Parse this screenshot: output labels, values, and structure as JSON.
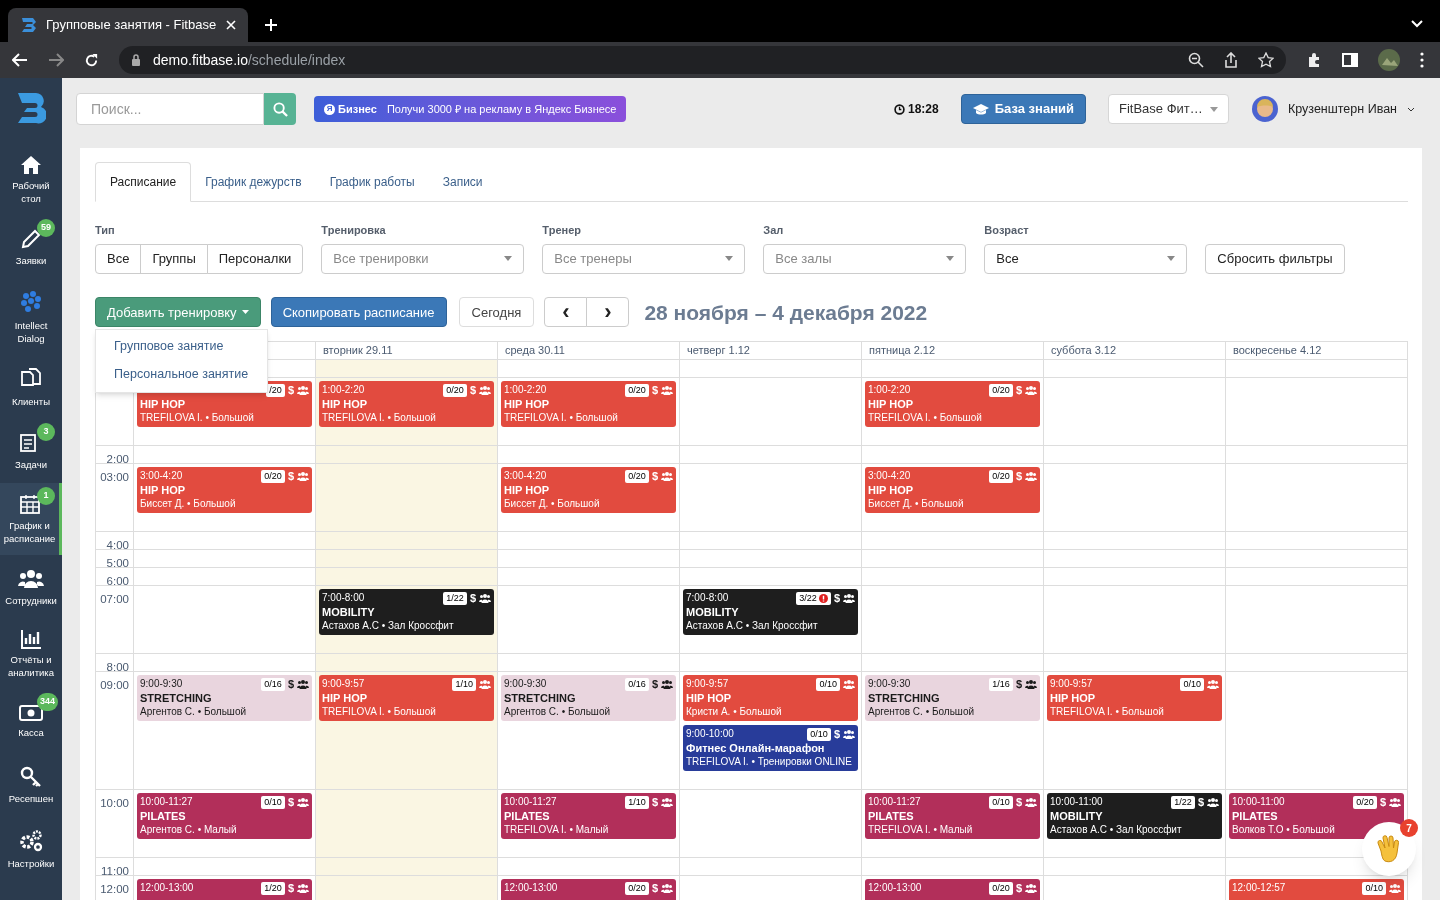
{
  "browser": {
    "tab_title": "Групповые занятия - Fitbase",
    "url_host": "demo.fitbase.io",
    "url_path": "/schedule/index"
  },
  "sidebar": {
    "items": [
      {
        "label": "Рабочий стол",
        "selected": false
      },
      {
        "label": "Заявки",
        "badge": "59",
        "selected": false
      },
      {
        "label": "Intellect Dialog",
        "selected": false
      },
      {
        "label": "Клиенты",
        "selected": false
      },
      {
        "label": "Задачи",
        "badge": "3",
        "selected": false
      },
      {
        "label": "График и расписание",
        "badge": "1",
        "selected": true
      },
      {
        "label": "Сотрудники",
        "selected": false
      },
      {
        "label": "Отчёты и аналитика",
        "selected": false
      },
      {
        "label": "Касса",
        "badge": "344",
        "selected": false
      },
      {
        "label": "Ресепшен",
        "selected": false
      },
      {
        "label": "Настройки",
        "selected": false
      }
    ]
  },
  "header": {
    "search": {
      "placeholder": "Поиск..."
    },
    "promo": {
      "logo_letter": "Я",
      "logo_word": "Бизнес",
      "text": "Получи 3000 ₽ на рекламу в Яндекс Бизнесе"
    },
    "time": "18:28",
    "knowledge_button": "База знаний",
    "club_select": "FitBase Фит…",
    "user": "Крузенштерн Иван"
  },
  "tabs": [
    {
      "label": "Расписание",
      "selected": true
    },
    {
      "label": "График дежурств",
      "selected": false
    },
    {
      "label": "График работы",
      "selected": false
    },
    {
      "label": "Записи",
      "selected": false
    }
  ],
  "filters": {
    "type": {
      "label": "Тип",
      "options": [
        "Все",
        "Группы",
        "Персоналки"
      ]
    },
    "selects": [
      {
        "label": "Тренировка",
        "placeholder": "Все тренировки"
      },
      {
        "label": "Тренер",
        "placeholder": "Все тренеры"
      },
      {
        "label": "Зал",
        "placeholder": "Все залы"
      },
      {
        "label": "Возраст",
        "value": "Все"
      }
    ],
    "reset": "Сбросить фильтры"
  },
  "toolbar": {
    "add_button": "Добавить тренировку",
    "add_menu": {
      "expanded": true,
      "items": [
        "Групповое занятие",
        "Персональное занятие"
      ]
    },
    "copy_button": "Скопировать расписание",
    "today_button": "Сегодня",
    "prev": "‹",
    "next": "›",
    "range": "28 ноября – 4 декабря 2022"
  },
  "calendar": {
    "days": [
      {
        "kind": "mon"
      },
      {
        "kind": "tue",
        "label": "вторник 29.11",
        "today": true
      },
      {
        "kind": "wed",
        "label": "среда 30.11"
      },
      {
        "kind": "thu",
        "label": "четверг 1.12"
      },
      {
        "kind": "fri",
        "label": "пятница 2.12"
      },
      {
        "kind": "sat",
        "label": "суббота 3.12"
      },
      {
        "kind": "sun",
        "label": "воскресенье 4.12"
      }
    ],
    "rows": [
      {},
      {
        "cells": [
          {
            "kind": "mon",
            "events": [
              {
                "kind": "hiphop",
                "count": "/20",
                "fee": "$",
                "title": "HIP HOP",
                "info": "TREFILOVA I. • Большой"
              }
            ]
          },
          {
            "kind": "tue",
            "events": [
              {
                "kind": "hiphop",
                "time": "1:00-2:20",
                "count": "0/20",
                "fee": "$",
                "title": "HIP HOP",
                "info": "TREFILOVA I. • Большой"
              }
            ]
          },
          {
            "kind": "wed",
            "events": [
              {
                "kind": "hiphop",
                "time": "1:00-2:20",
                "count": "0/20",
                "fee": "$",
                "title": "HIP HOP",
                "info": "TREFILOVA I. • Большой"
              }
            ]
          },
          {
            "kind": "fri",
            "events": [
              {
                "kind": "hiphop",
                "time": "1:00-2:20",
                "count": "0/20",
                "fee": "$",
                "title": "HIP HOP",
                "info": "TREFILOVA I. • Большой"
              }
            ]
          }
        ]
      },
      {
        "time": "2:00"
      },
      {
        "time": "03:00",
        "cells": [
          {
            "kind": "mon",
            "events": [
              {
                "kind": "hiphop",
                "time": "3:00-4:20",
                "count": "0/20",
                "fee": "$",
                "title": "HIP HOP",
                "info": "Биссет Д. • Большой"
              }
            ]
          },
          {
            "kind": "wed",
            "events": [
              {
                "kind": "hiphop",
                "time": "3:00-4:20",
                "count": "0/20",
                "fee": "$",
                "title": "HIP HOP",
                "info": "Биссет Д. • Большой"
              }
            ]
          },
          {
            "kind": "fri",
            "events": [
              {
                "kind": "hiphop",
                "time": "3:00-4:20",
                "count": "0/20",
                "fee": "$",
                "title": "HIP HOP",
                "info": "Биссет Д. • Большой"
              }
            ]
          }
        ]
      },
      {
        "time": "4:00"
      },
      {
        "time": "5:00"
      },
      {
        "time": "6:00"
      },
      {
        "time": "07:00",
        "cells": [
          {
            "kind": "tue",
            "events": [
              {
                "kind": "mobility",
                "time": "7:00-8:00",
                "count": "1/22",
                "fee": "$",
                "title": "MOBILITY",
                "info": "Астахов А.С • Зал Кроссфит"
              }
            ]
          },
          {
            "kind": "thu",
            "events": [
              {
                "kind": "mobility",
                "time": "7:00-8:00",
                "count": "3/22",
                "alert": true,
                "fee": "$",
                "title": "MOBILITY",
                "info": "Астахов А.С • Зал Кроссфит"
              }
            ]
          }
        ]
      },
      {
        "time": "8:00"
      },
      {
        "time": "09:00",
        "cells": [
          {
            "kind": "mon",
            "events": [
              {
                "kind": "stretching",
                "time": "9:00-9:30",
                "count": "0/16",
                "fee": "$",
                "title": "STRETCHING",
                "info": "Аргентов С. • Большой"
              }
            ]
          },
          {
            "kind": "tue",
            "events": [
              {
                "kind": "hiphop",
                "time": "9:00-9:57",
                "count": "1/10",
                "title": "HIP HOP",
                "info": "TREFILOVA I. • Большой"
              }
            ]
          },
          {
            "kind": "wed",
            "events": [
              {
                "kind": "stretching",
                "time": "9:00-9:30",
                "count": "0/16",
                "fee": "$",
                "title": "STRETCHING",
                "info": "Аргентов С. • Большой"
              }
            ]
          },
          {
            "kind": "thu",
            "events": [
              {
                "kind": "hiphop",
                "time": "9:00-9:57",
                "count": "0/10",
                "title": "HIP HOP",
                "info": "Кристи А. • Большой"
              },
              {
                "kind": "online",
                "time": "9:00-10:00",
                "count": "0/10",
                "fee": "$",
                "title": "Фитнес Онлайн-марафон",
                "info": "TREFILOVA I. • Тренировки ONLINE"
              }
            ]
          },
          {
            "kind": "fri",
            "events": [
              {
                "kind": "stretching",
                "time": "9:00-9:30",
                "count": "1/16",
                "fee": "$",
                "title": "STRETCHING",
                "info": "Аргентов С. • Большой"
              }
            ]
          },
          {
            "kind": "sat",
            "events": [
              {
                "kind": "hiphop",
                "time": "9:00-9:57",
                "count": "0/10",
                "title": "HIP HOP",
                "info": "TREFILOVA I. • Большой"
              }
            ]
          }
        ]
      },
      {
        "time": "10:00",
        "cells": [
          {
            "kind": "mon",
            "events": [
              {
                "kind": "pilates",
                "time": "10:00-11:27",
                "count": "0/10",
                "fee": "$",
                "title": "PILATES",
                "info": "Аргентов С. • Малый"
              }
            ]
          },
          {
            "kind": "wed",
            "events": [
              {
                "kind": "pilates",
                "time": "10:00-11:27",
                "count": "1/10",
                "fee": "$",
                "title": "PILATES",
                "info": "TREFILOVA I. • Малый"
              }
            ]
          },
          {
            "kind": "fri",
            "events": [
              {
                "kind": "pilates",
                "time": "10:00-11:27",
                "count": "0/10",
                "fee": "$",
                "title": "PILATES",
                "info": "TREFILOVA I. • Малый"
              }
            ]
          },
          {
            "kind": "sat",
            "events": [
              {
                "kind": "mobility",
                "time": "10:00-11:00",
                "count": "1/22",
                "fee": "$",
                "title": "MOBILITY",
                "info": "Астахов А.С • Зал Кроссфит"
              }
            ]
          },
          {
            "kind": "sun",
            "events": [
              {
                "kind": "pilates",
                "time": "10:00-11:00",
                "count": "0/20",
                "fee": "$",
                "title": "PILATES",
                "info": "Волков Т.О • Большой"
              }
            ]
          }
        ]
      },
      {
        "time": "11:00"
      },
      {
        "time": "12:00",
        "cells": [
          {
            "kind": "mon",
            "events": [
              {
                "kind": "pilates",
                "time": "12:00-13:00",
                "count": "1/20",
                "fee": "$"
              }
            ]
          },
          {
            "kind": "wed",
            "events": [
              {
                "kind": "pilates",
                "time": "12:00-13:00",
                "count": "0/20",
                "fee": "$"
              }
            ]
          },
          {
            "kind": "fri",
            "events": [
              {
                "kind": "pilates",
                "time": "12:00-13:00",
                "count": "0/20",
                "fee": "$"
              }
            ]
          },
          {
            "kind": "sun",
            "events": [
              {
                "kind": "hiphop",
                "time": "12:00-12:57",
                "count": "0/10"
              }
            ]
          }
        ]
      }
    ]
  },
  "chat": {
    "badge": "7"
  }
}
